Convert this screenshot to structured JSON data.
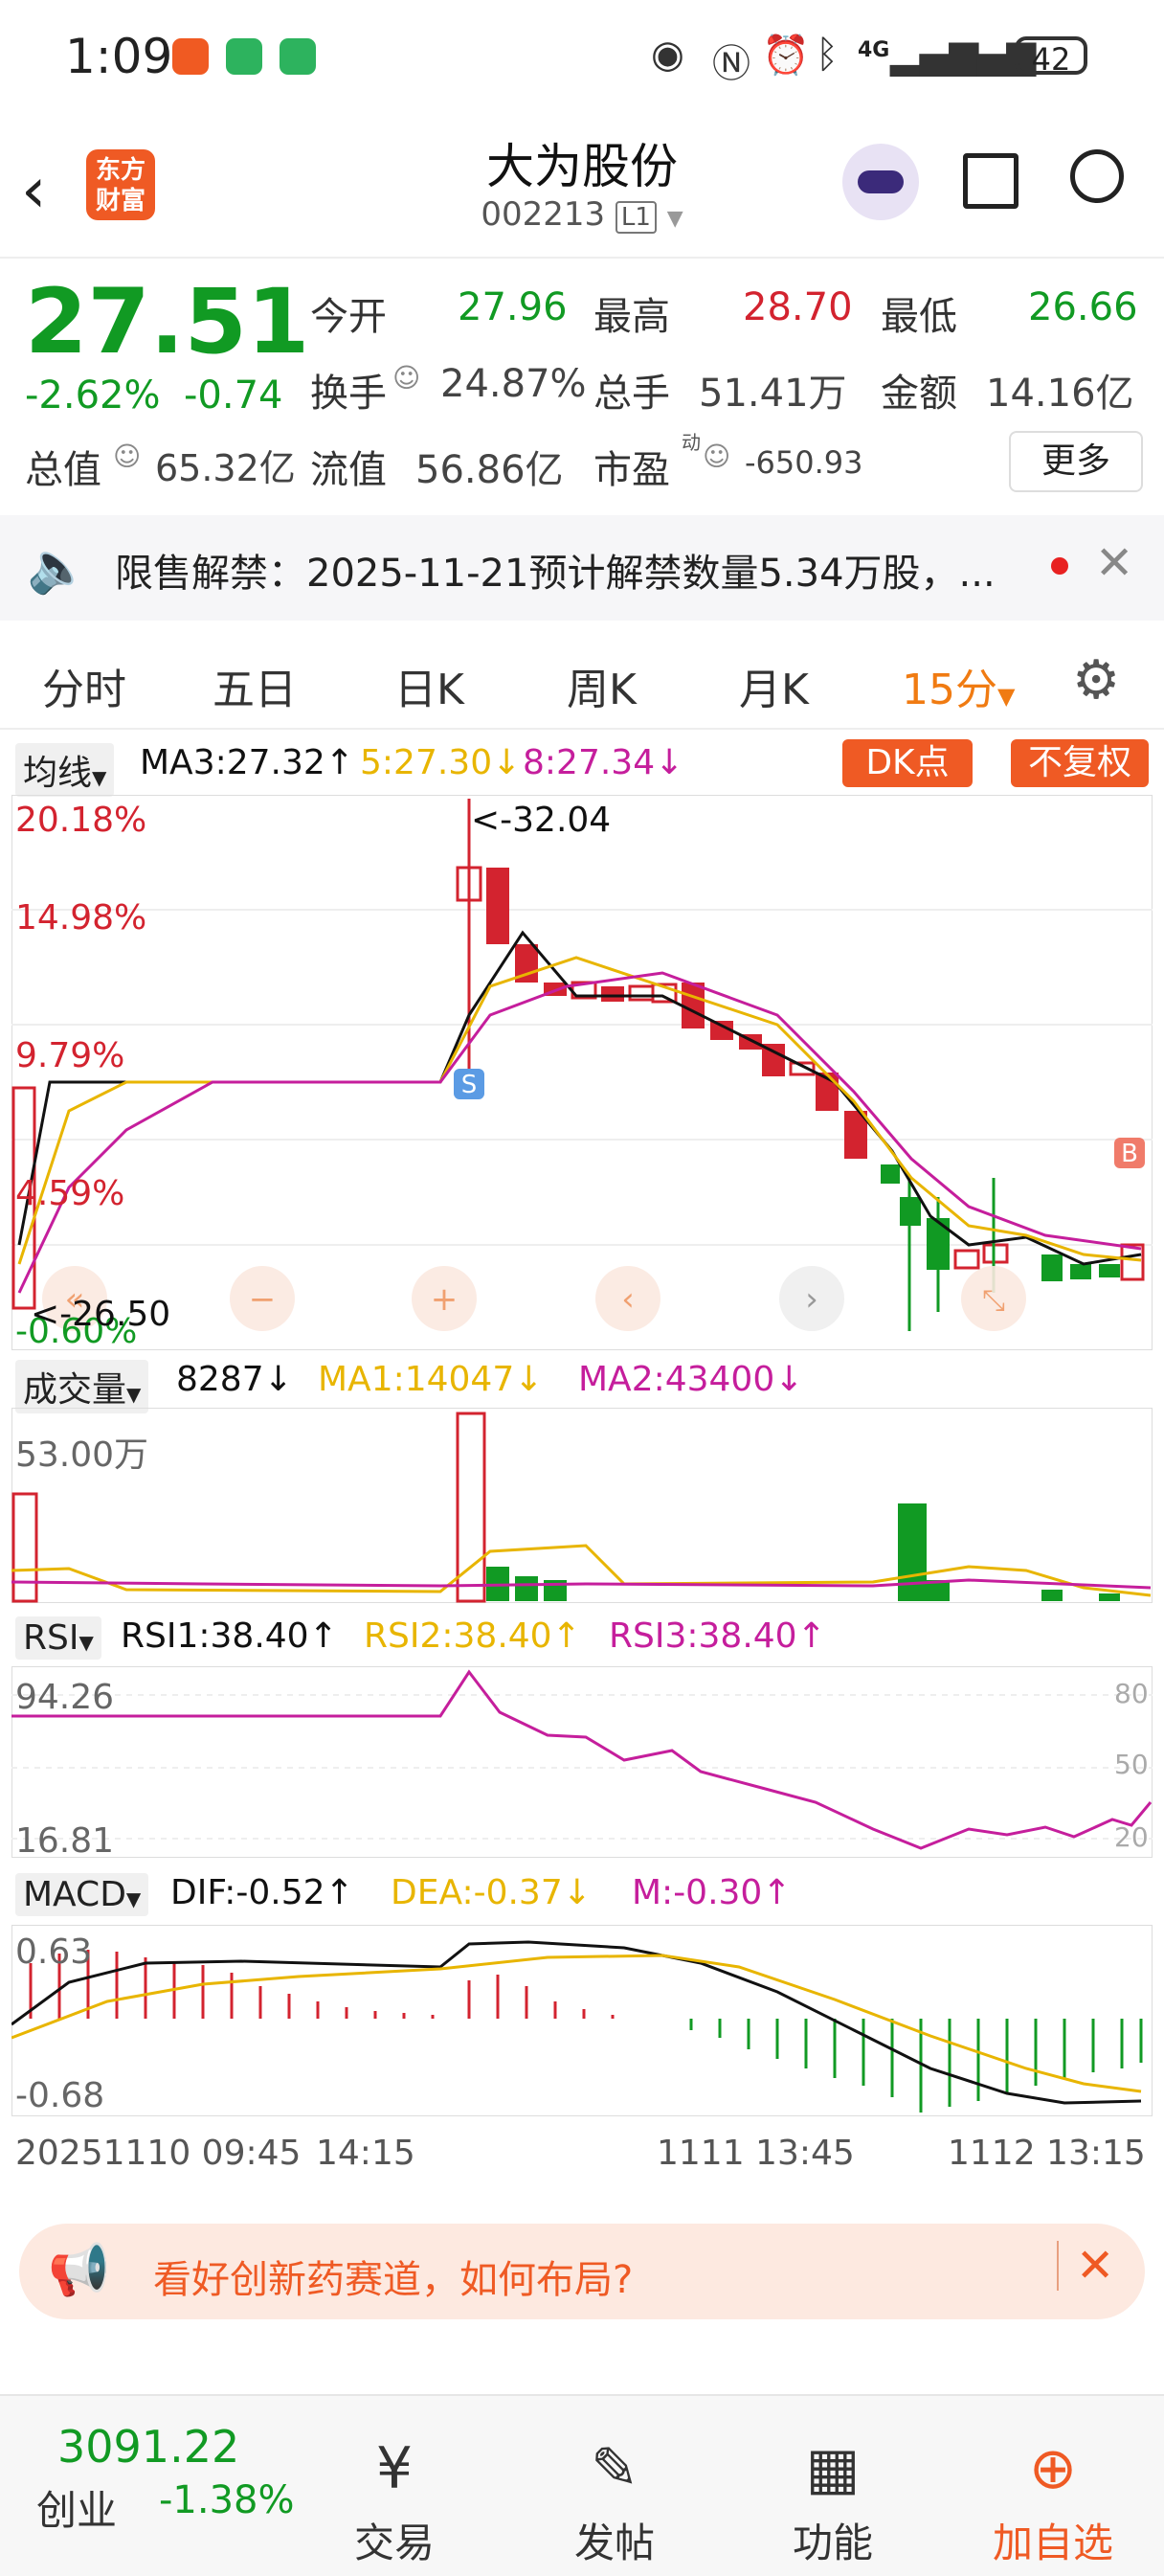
{
  "status_bar": {
    "time": "1:09",
    "battery": "42",
    "signal_label": "4G"
  },
  "header": {
    "back_icon": "back-arrow-icon",
    "logo_text": "东方财富",
    "title": "大为股份",
    "code": "002213",
    "code_badge": "L1"
  },
  "quote": {
    "price": "27.51",
    "change_pct": "-2.62%",
    "change": "-0.74",
    "open_label": "今开",
    "open": "27.96",
    "high_label": "最高",
    "high": "28.70",
    "low_label": "最低",
    "low": "26.66",
    "turnover_label": "换手",
    "turnover": "24.87%",
    "volume_label": "总手",
    "volume": "51.41万",
    "amount_label": "金额",
    "amount": "14.16亿",
    "mktcap_label": "总值",
    "mktcap": "65.32亿",
    "float_label": "流值",
    "float": "56.86亿",
    "pe_label": "市盈",
    "pe_sup": "动",
    "pe": "-650.93",
    "more_label": "更多"
  },
  "notice": {
    "text": "限售解禁：2025-11-21预计解禁数量5.34万股，..."
  },
  "tabs": [
    "分时",
    "五日",
    "日K",
    "周K",
    "月K",
    "15分"
  ],
  "main_chart": {
    "indicator_select": "均线",
    "ma3": "MA3:27.32↑",
    "ma5": "5:27.30↓",
    "ma8": "8:27.34↓",
    "dk_label": "DK点",
    "fq_label": "不复权",
    "y_labels": [
      "20.18%",
      "14.98%",
      "9.79%",
      "4.59%",
      "-0.60%"
    ],
    "max_note": "<-32.04",
    "min_note": "<-26.50",
    "s_marker": "S",
    "b_marker": "B",
    "colors": {
      "up": "#d3232f",
      "down": "#119a23",
      "ma3": "#111111",
      "ma5": "#e8b500",
      "ma8": "#c51e9c"
    }
  },
  "volume": {
    "select": "成交量",
    "value": "8287↓",
    "ma1": "MA1:14047↓",
    "ma2": "MA2:43400↓",
    "max_label": "53.00万"
  },
  "rsi": {
    "select": "RSI",
    "rsi1": "RSI1:38.40↑",
    "rsi2": "RSI2:38.40↑",
    "rsi3": "RSI3:38.40↑",
    "max_label": "94.26",
    "min_label": "16.81",
    "levels": [
      "80",
      "50",
      "20"
    ]
  },
  "macd": {
    "select": "MACD",
    "dif": "DIF:-0.52↑",
    "dea": "DEA:-0.37↓",
    "m": "M:-0.30↑",
    "max_label": "0.63",
    "min_label": "-0.68"
  },
  "time_axis": [
    "20251110 09:45",
    "14:15",
    "1111 13:45",
    "1112 13:15"
  ],
  "ad_banner": {
    "text": "看好创新药赛道，如何布局?"
  },
  "bottom_bar": {
    "index_value": "3091.22",
    "index_name": "创业",
    "index_change": "-1.38%",
    "items": [
      "交易",
      "发帖",
      "功能",
      "加自选"
    ]
  }
}
